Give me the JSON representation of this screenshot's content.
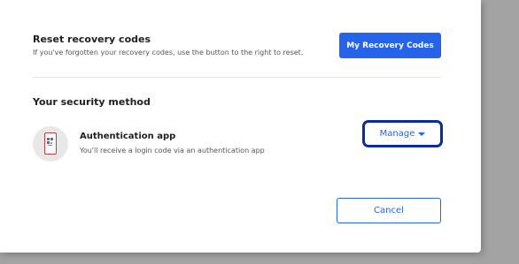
{
  "recovery": {
    "title": "Reset recovery codes",
    "description": "If you've forgotten your recovery codes, use the button to the right to reset.",
    "button_label": "My Recovery Codes"
  },
  "security": {
    "title": "Your security method",
    "method": {
      "icon": "phone-qr-icon",
      "title": "Authentication app",
      "description": "You'll receive a login code via an authentication app"
    },
    "manage_label": "Manage",
    "manage_icon": "caret-down-icon"
  },
  "footer": {
    "cancel_label": "Cancel"
  },
  "colors": {
    "accent": "#2563eb",
    "focus_ring": "#0b2a9c"
  }
}
